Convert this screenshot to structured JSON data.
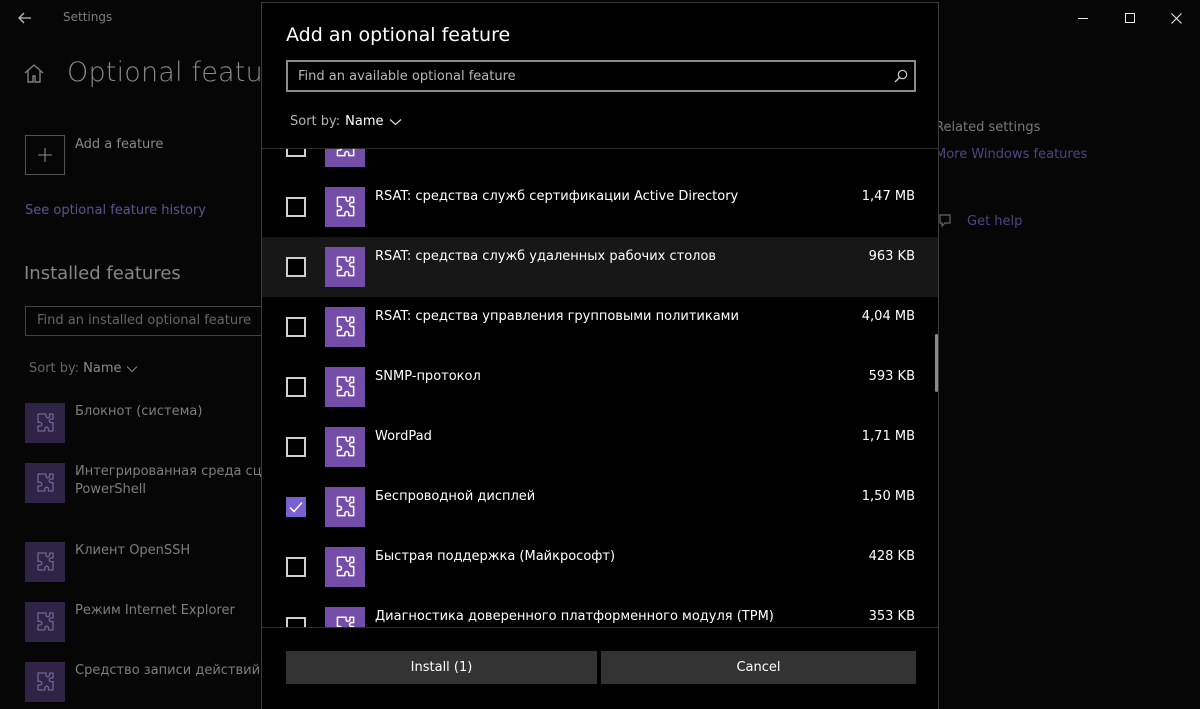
{
  "window": {
    "app_title": "Settings",
    "page_title": "Optional features",
    "add_feature_label": "Add a feature",
    "history_link": "See optional feature history",
    "installed_title": "Installed features",
    "installed_search_placeholder": "Find an installed optional feature",
    "sort_label": "Sort by:",
    "sort_value": "Name",
    "installed_items": [
      {
        "label": "Блокнот (система)"
      },
      {
        "label": "Интегрированная среда сценариев",
        "label2": "PowerShell"
      },
      {
        "label": "Клиент OpenSSH"
      },
      {
        "label": "Режим Internet Explorer"
      },
      {
        "label": "Средство записи действий"
      }
    ],
    "related_title": "Related settings",
    "related_link": "More Windows features",
    "help_link": "Get help"
  },
  "dialog": {
    "title": "Add an optional feature",
    "search_placeholder": "Find an available optional feature",
    "sort_label": "Sort by:",
    "sort_value": "Name",
    "features": [
      {
        "name": "",
        "size": "",
        "checked": false
      },
      {
        "name": "RSAT: средства служб сертификации Active Directory",
        "size": "1,47 MB",
        "checked": false
      },
      {
        "name": "RSAT: средства служб удаленных рабочих столов",
        "size": "963 KB",
        "checked": false,
        "highlighted": true
      },
      {
        "name": "RSAT: средства управления групповыми политиками",
        "size": "4,04 MB",
        "checked": false
      },
      {
        "name": "SNMP-протокол",
        "size": "593 KB",
        "checked": false
      },
      {
        "name": "WordPad",
        "size": "1,71 MB",
        "checked": false
      },
      {
        "name": "Беспроводной дисплей",
        "size": "1,50 MB",
        "checked": true
      },
      {
        "name": "Быстрая поддержка (Майкрософт)",
        "size": "428 KB",
        "checked": false
      },
      {
        "name": "Диагностика доверенного платформенного модуля (TPM)",
        "size": "353 KB",
        "checked": false
      }
    ],
    "install_label": "Install (1)",
    "cancel_label": "Cancel"
  },
  "colors": {
    "accent": "#744da9",
    "checkbox_checked": "#7a5fd0",
    "button_bg": "#333333"
  },
  "icons": {
    "feature_tile": "puzzle-piece-icon",
    "search": "search-icon",
    "chevron": "chevron-down-icon"
  }
}
